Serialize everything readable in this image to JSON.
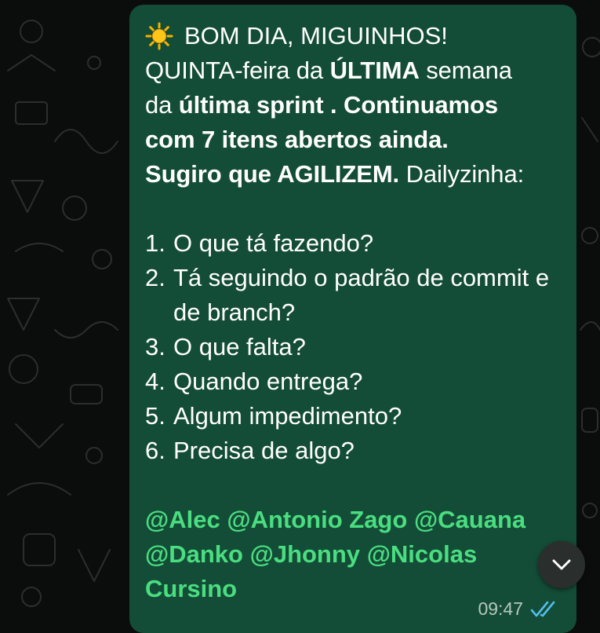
{
  "message": {
    "greeting_icon": "sun-icon",
    "greeting": "BOM DIA, MIGUINHOS!",
    "line2_a": "QUINTA-feira da ",
    "line2_b": "ÚLTIMA",
    "line2_c": " semana",
    "line3_a": "da ",
    "line3_b": "última sprint . Continuamos",
    "line4": "com 7 itens abertos ainda.",
    "line5_a": "Sugiro que AGILIZEM.",
    "line5_b": " Dailyzinha:",
    "list": [
      {
        "num": "1.",
        "text": "O que tá fazendo?"
      },
      {
        "num": "2.",
        "text": "Tá seguindo o padrão de commit e de branch?"
      },
      {
        "num": "3.",
        "text": "O que falta?"
      },
      {
        "num": "4.",
        "text": "Quando entrega?"
      },
      {
        "num": "5.",
        "text": "Algum impedimento?"
      },
      {
        "num": "6.",
        "text": "Precisa de algo?"
      }
    ],
    "mentions": [
      "@Alec",
      "@Antonio Zago",
      "@Cauana",
      "@Danko",
      "@Jhonny",
      "@Nicolas Cursino"
    ],
    "time": "09:47",
    "status_icon": "double-check-icon",
    "colors": {
      "bubble": "#144d37",
      "mention": "#4ade80",
      "check": "#53bdeb"
    }
  },
  "scroll_button": {
    "icon": "chevron-down-icon"
  }
}
